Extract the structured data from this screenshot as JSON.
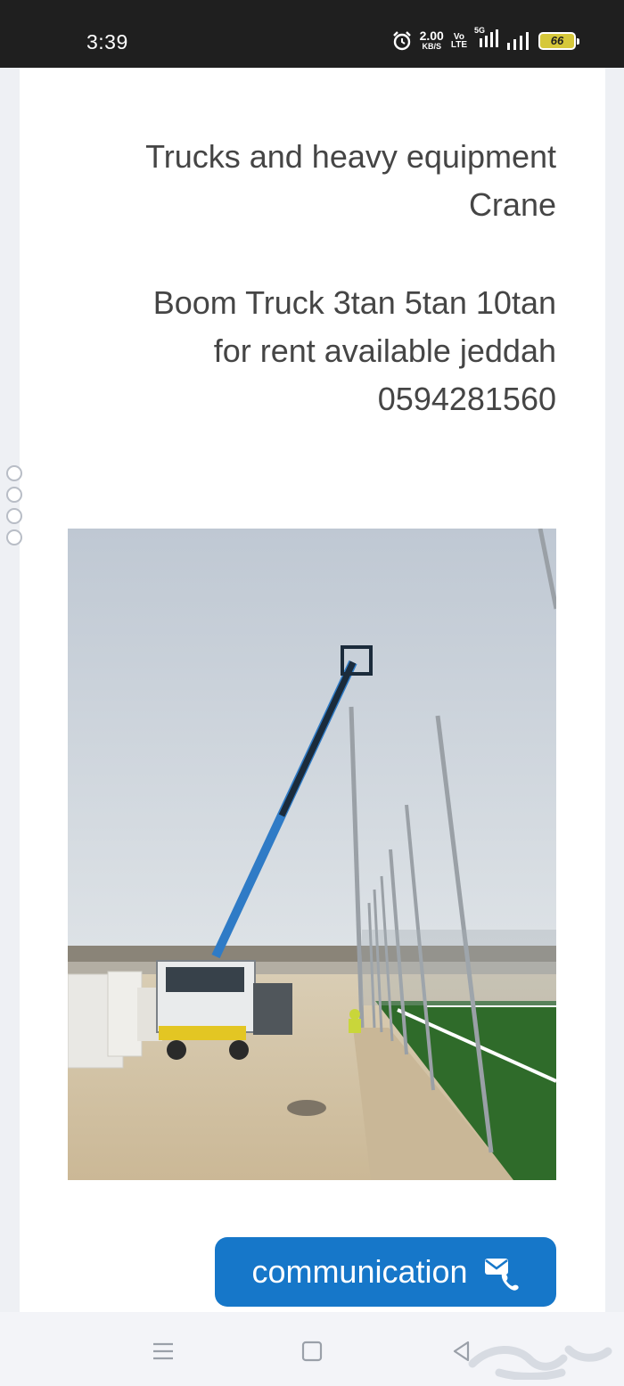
{
  "status_bar": {
    "time": "3:39",
    "net_speed_value": "2.00",
    "net_speed_unit": "KB/S",
    "volte_top": "Vo",
    "volte_bottom": "LTE",
    "network": "5G",
    "battery": "66"
  },
  "listing": {
    "line_1": "Trucks and heavy equipment",
    "line_2": "Crane",
    "line_3": "Boom Truck 3tan 5tan 10tan",
    "line_4": "for rent available jeddah",
    "line_5": "0594281560"
  },
  "actions": {
    "communication_label": "communication"
  },
  "colors": {
    "accent": "#1677c9",
    "status_bar": "#1f1f1f",
    "text": "#454545"
  },
  "icons": [
    "alarm-icon",
    "signal-icon",
    "battery-icon",
    "phone-mail-icon",
    "menu-icon",
    "home-icon",
    "back-icon"
  ]
}
